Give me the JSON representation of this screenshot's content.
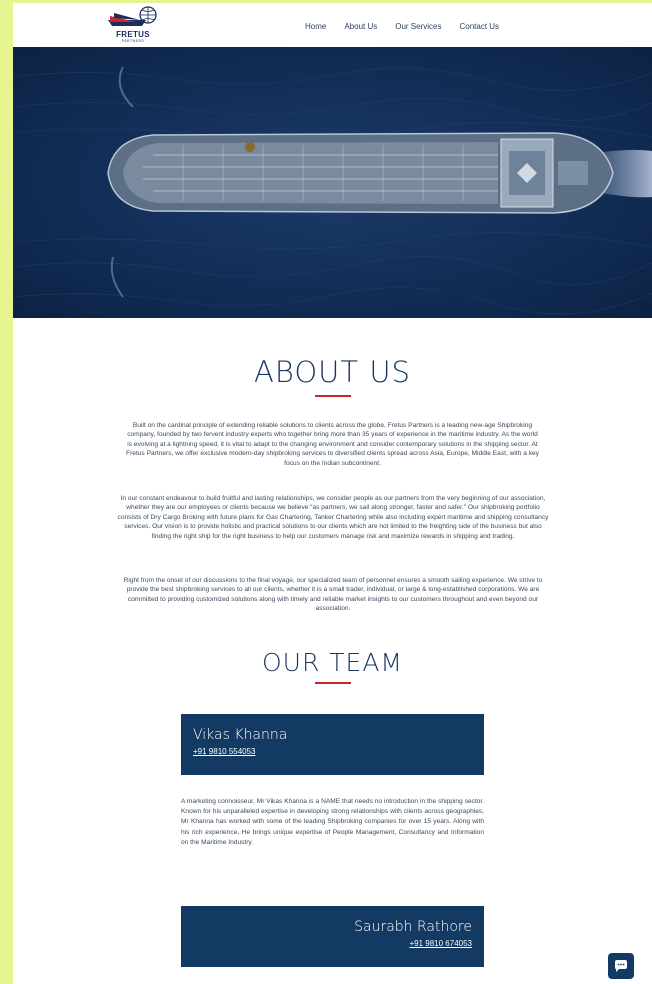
{
  "header": {
    "logo_text": "FRETUS",
    "logo_sub": "PARTNERS",
    "nav": [
      "Home",
      "About Us",
      "Our Services",
      "Contact Us"
    ]
  },
  "about": {
    "title": "ABOUT US",
    "paragraphs": [
      "Built on the cardinal principle of extending reliable solutions to clients across the globe, Fretus Partners is a leading new-age Shipbroking company, founded by two fervent industry experts who together bring more than 35 years of experience in the maritime industry. As the world is evolving at a lightning speed, it is vital to adapt to the changing environment and consider contemporary solutions in the shipping sector. At Fretus Partners, we offer exclusive modern-day shipbroking services to diversified clients spread across Asia, Europe, Middle East, with a key focus on the Indian subcontinent.",
      "In our constant endeavour to build fruitful and lasting relationships, we consider people as our partners from the very beginning of our association, whether they are our employees or clients because we believe “as partners, we sail along stronger, faster and safer.” Our shipbroking portfolio consists of Dry Cargo Broking with future plans for Gas Chartering, Tanker Chartering while also including expert maritime and shipping consultancy services. Our vision is to provide holistic and practical solutions to our clients which are not limited to the freighting side of the business but also finding the right ship for the right business to help our customers manage risk and maximize rewards in shipping and trading.",
      "Right from the onset of our discussions to the final voyage, our specialized team of personnel ensures a smooth sailing experience. We strive to provide the best shipbroking services to all our clients, whether it is a small trader, individual, or large & long-established corporations. We are committed to providing customized solutions along with timely and reliable market insights to our customers throughout and even beyond our association."
    ]
  },
  "team": {
    "title": "OUR TEAM",
    "members": [
      {
        "name": "Vikas Khanna",
        "phone": "+91 9810 554053",
        "bio": "A marketing connoisseur, Mr Vikas Khanna is a NAME that needs no introduction in the shipping sector. Known for his unparalleled expertise in developing strong relationships with clients across geographies, Mr Khanna has worked with some of the leading Shipbroking companies for over 15 years. Along with his rich experience, He brings unique expertise of People Management, Consultancy and Information on the Maritime Industry."
      },
      {
        "name": "Saurabh Rathore",
        "phone": "+91 9810 674053"
      }
    ]
  },
  "colors": {
    "navy": "#133a63",
    "accent_red": "#d0242b",
    "frame": "#e6f58f"
  },
  "icons": {
    "chat": "chat-bubble-icon"
  }
}
